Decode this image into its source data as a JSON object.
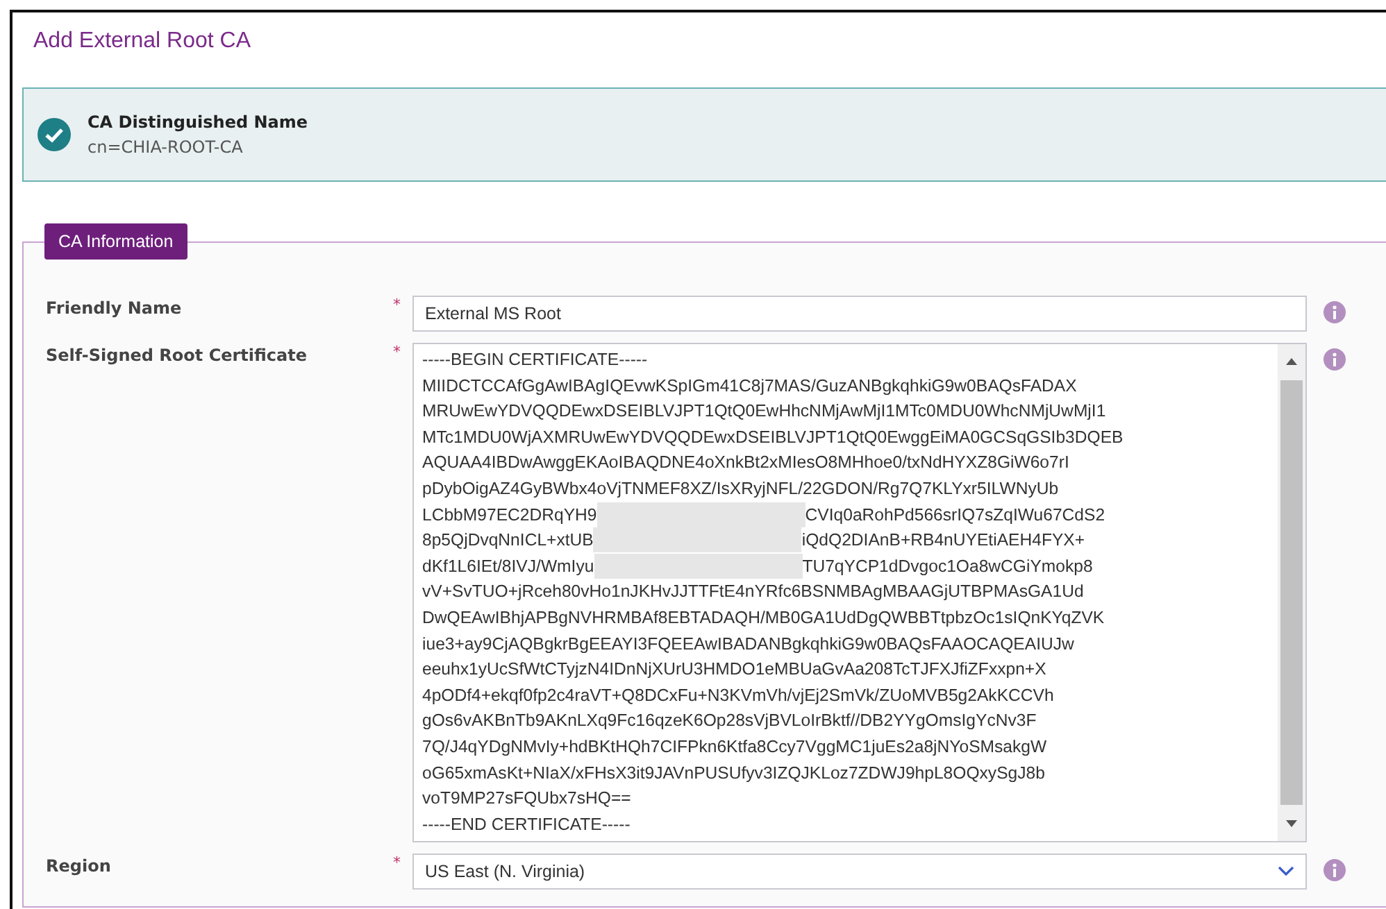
{
  "title": "Add External Root CA",
  "banner": {
    "checked": true,
    "heading": "CA Distinguished Name",
    "value": "cn=CHIA-ROOT-CA"
  },
  "section": {
    "legend": "CA Information"
  },
  "fields": [
    {
      "kind": "text",
      "label": "Friendly Name",
      "required_mark": "*",
      "value": "External MS Root"
    },
    {
      "kind": "certificate",
      "label": "Self-Signed Root Certificate",
      "required_mark": "*",
      "lines": [
        {
          "kind": "plain",
          "text": "-----BEGIN CERTIFICATE-----"
        },
        {
          "kind": "plain",
          "text": "MIIDCTCCAfGgAwIBAgIQEvwKSpIGm41C8j7MAS/GuzANBgkqhkiG9w0BAQsFADAX"
        },
        {
          "kind": "plain",
          "text": "MRUwEwYDVQQDEwxDSEIBLVJPT1QtQ0EwHhcNMjAwMjI1MTc0MDU0WhcNMjUwMjI1"
        },
        {
          "kind": "plain",
          "text": "MTc1MDU0WjAXMRUwEwYDVQQDEwxDSEIBLVJPT1QtQ0EwggEiMA0GCSqGSIb3DQEB"
        },
        {
          "kind": "plain",
          "text": "AQUAA4IBDwAwggEKAoIBAQDNE4oXnkBt2xMIesO8MHhoe0/txNdHYXZ8GiW6o7rI"
        },
        {
          "kind": "plain",
          "text": "pDybOigAZ4GyBWbx4oVjTNMEF8XZ/IsXRyjNFL/22GDON/Rg7Q7KLYxr5ILWNyUb"
        },
        {
          "kind": "redacted",
          "left": "LCbbM97EC2DRqYH9",
          "right": "CVIq0aRohPd566srIQ7sZqIWu67CdS2"
        },
        {
          "kind": "redacted",
          "left": "8p5QjDvqNnICL+xtUB",
          "right": "iQdQ2DIAnB+RB4nUYEtiAEH4FYX+"
        },
        {
          "kind": "redacted",
          "left": "dKf1L6IEt/8IVJ/WmIyu",
          "right": "TU7qYCP1dDvgoc1Oa8wCGiYmokp8"
        },
        {
          "kind": "plain",
          "text": "vV+SvTUO+jRceh80vHo1nJKHvJJTTFtE4nYRfc6BSNMBAgMBAAGjUTBPMAsGA1Ud"
        },
        {
          "kind": "plain",
          "text": "DwQEAwIBhjAPBgNVHRMBAf8EBTADAQH/MB0GA1UdDgQWBBTtpbzOc1sIQnKYqZVK"
        },
        {
          "kind": "plain",
          "text": "iue3+ay9CjAQBgkrBgEEAYI3FQEEAwIBADANBgkqhkiG9w0BAQsFAAOCAQEAIUJw"
        },
        {
          "kind": "plain",
          "text": "eeuhx1yUcSfWtCTyjzN4IDnNjXUrU3HMDO1eMBUaGvAa208TcTJFXJfiZFxxpn+X"
        },
        {
          "kind": "plain",
          "text": "4pODf4+ekqf0fp2c4raVT+Q8DCxFu+N3KVmVh/vjEj2SmVk/ZUoMVB5g2AkKCCVh"
        },
        {
          "kind": "plain",
          "text": "gOs6vAKBnTb9AKnLXq9Fc16qzeK6Op28sVjBVLoIrBktf//DB2YYgOmsIgYcNv3F"
        },
        {
          "kind": "plain",
          "text": "7Q/J4qYDgNMvIy+hdBKtHQh7CIFPkn6Ktfa8Ccy7VggMC1juEs2a8jNYoSMsakgW"
        },
        {
          "kind": "plain",
          "text": "oG65xmAsKt+NIaX/xFHsX3it9JAVnPUSUfyv3IZQJKLoz7ZDWJ9hpL8OQxySgJ8b"
        },
        {
          "kind": "plain",
          "text": "voT9MP27sFQUbx7sHQ=="
        },
        {
          "kind": "plain",
          "text": "-----END CERTIFICATE-----"
        }
      ]
    },
    {
      "kind": "select",
      "label": "Region",
      "required_mark": "*",
      "value": "US East (N. Virginia)"
    }
  ]
}
